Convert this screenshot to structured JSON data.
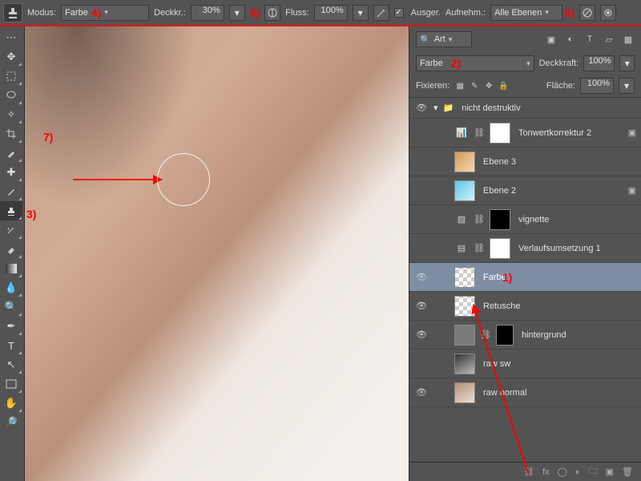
{
  "optionsBar": {
    "modeLabel": "Modus:",
    "modeValue": "Farbe",
    "opacityLabel": "Deckkr.:",
    "opacityValue": "30%",
    "flowLabel": "Fluss:",
    "flowValue": "100%",
    "alignedLabel": "Ausger.",
    "sampleLabel": "Aufnehm.:",
    "sampleValue": "Alle Ebenen"
  },
  "layersPanel": {
    "filterValue": "Art",
    "blendLabel": "",
    "blendValue": "Farbe",
    "opacityLabel": "Deckkraft:",
    "opacityValue": "100%",
    "lockLabel": "Fixieren:",
    "fillLabel": "Fläche:",
    "fillValue": "100%",
    "groupName": "nicht destruktiv",
    "layers": [
      {
        "name": "Tonwertkorrektur 2"
      },
      {
        "name": "Ebene 3"
      },
      {
        "name": "Ebene 2"
      },
      {
        "name": "vignette"
      },
      {
        "name": "Verlaufsumsetzung 1"
      },
      {
        "name": "Farbe"
      },
      {
        "name": "Retusche"
      },
      {
        "name": "hintergrund"
      },
      {
        "name": "raw sw"
      },
      {
        "name": "raw normal"
      }
    ]
  },
  "annotations": {
    "a1": "1)",
    "a2": "2)",
    "a3": "3)",
    "a4": "4)",
    "a5": "5)",
    "a6": "6)",
    "a7": "7)"
  }
}
